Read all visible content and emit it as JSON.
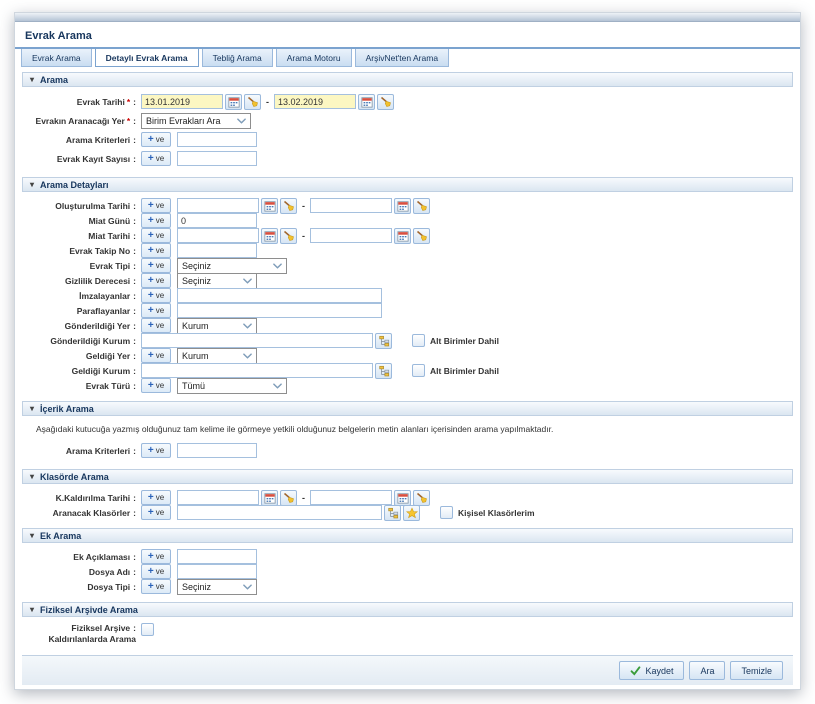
{
  "window": {
    "title": "Evrak Arama"
  },
  "tabs": [
    {
      "label": "Evrak Arama"
    },
    {
      "label": "Detaylı Evrak Arama"
    },
    {
      "label": "Tebliğ Arama"
    },
    {
      "label": "Arama Motoru"
    },
    {
      "label": "ArşivNet'ten Arama"
    }
  ],
  "common": {
    "plus": "+",
    "and_label": "ve",
    "required_marker": "*",
    "colon": ":",
    "range_separator": "-"
  },
  "sections": {
    "arama": {
      "title": "Arama",
      "evrak_tarihi": {
        "label": "Evrak Tarihi",
        "from": "13.01.2019",
        "to": "13.02.2019"
      },
      "aranacak_yer": {
        "label": "Evrakın Aranacağı Yer",
        "value": "Birim Evrakları Ara"
      },
      "arama_kriterleri": {
        "label": "Arama Kriterleri",
        "value": ""
      },
      "evrak_kayit_sayisi": {
        "label": "Evrak Kayıt Sayısı",
        "value": ""
      }
    },
    "arama_detaylari": {
      "title": "Arama Detayları",
      "olusturulma_tarihi": {
        "label": "Oluşturulma Tarihi",
        "from": "",
        "to": ""
      },
      "miat_gunu": {
        "label": "Miat Günü",
        "value": "0"
      },
      "miat_tarihi": {
        "label": "Miat Tarihi",
        "from": "",
        "to": ""
      },
      "evrak_takip_no": {
        "label": "Evrak Takip No",
        "value": ""
      },
      "evrak_tipi": {
        "label": "Evrak Tipi",
        "value": "Seçiniz"
      },
      "gizlilik_derecesi": {
        "label": "Gizlilik Derecesi",
        "value": "Seçiniz"
      },
      "imzalayanlar": {
        "label": "İmzalayanlar",
        "value": ""
      },
      "paraflayanlar": {
        "label": "Paraflayanlar",
        "value": ""
      },
      "gonderildigi_yer": {
        "label": "Gönderildiği Yer",
        "value": "Kurum"
      },
      "gonderildigi_kurum": {
        "label": "Gönderildiği Kurum",
        "value": "",
        "checkbox_label": "Alt Birimler Dahil"
      },
      "geldigi_yer": {
        "label": "Geldiği Yer",
        "value": "Kurum"
      },
      "geldigi_kurum": {
        "label": "Geldiği Kurum",
        "value": "",
        "checkbox_label": "Alt Birimler Dahil"
      },
      "evrak_turu": {
        "label": "Evrak Türü",
        "value": "Tümü"
      }
    },
    "icerik_arama": {
      "title": "İçerik Arama",
      "info": "Aşağıdaki kutucuğa yazmış olduğunuz tam kelime ile görmeye yetkili olduğunuz belgelerin metin alanları içerisinden arama yapılmaktadır.",
      "arama_kriterleri": {
        "label": "Arama Kriterleri",
        "value": ""
      }
    },
    "klasorde_arama": {
      "title": "Klasörde Arama",
      "kaldirilma_tarihi": {
        "label": "K.Kaldırılma Tarihi",
        "from": "",
        "to": ""
      },
      "aranacak_klasorler": {
        "label": "Aranacak Klasörler",
        "value": "",
        "checkbox_label": "Kişisel Klasörlerim"
      }
    },
    "ek_arama": {
      "title": "Ek Arama",
      "ek_aciklamasi": {
        "label": "Ek Açıklaması",
        "value": ""
      },
      "dosya_adi": {
        "label": "Dosya Adı",
        "value": ""
      },
      "dosya_tipi": {
        "label": "Dosya Tipi",
        "value": "Seçiniz"
      }
    },
    "fiziksel_arama": {
      "title": "Fiziksel Arşivde Arama",
      "label_line1": "Fiziksel Arşive",
      "label_line2": "Kaldırılanlarda Arama"
    }
  },
  "footer": {
    "save": "Kaydet",
    "search": "Ara",
    "clear": "Temizle"
  },
  "colors": {
    "accent_blue": "#17365d",
    "date_highlight": "#fcf7c2",
    "required_red": "#cc0000",
    "check_green": "#3a9c3a"
  }
}
